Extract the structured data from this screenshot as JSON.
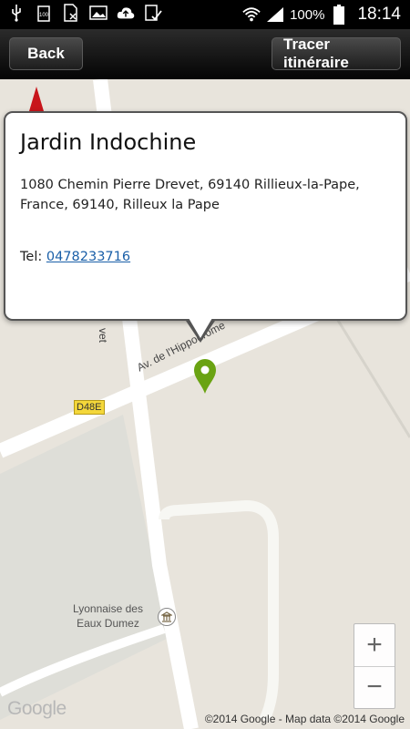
{
  "status_bar": {
    "battery_percent": "100%",
    "time": "18:14",
    "icons": [
      "usb-icon",
      "battery-100-icon",
      "sim-icon",
      "image-icon",
      "cloud-upload-icon",
      "check-clipboard-icon",
      "wifi-icon",
      "signal-icon",
      "battery-icon"
    ]
  },
  "action_bar": {
    "back_label": "Back",
    "route_label": "Tracer itinéraire"
  },
  "popup": {
    "title": "Jardin Indochine",
    "address": "1080 Chemin Pierre Drevet, 69140 Rillieux-la-Pape, France, 69140, Rilleux la Pape",
    "tel_prefix": "Tel: ",
    "tel_number": "0478233716"
  },
  "map": {
    "road_badge": "D48E",
    "street_main": "Av. de l'Hippodrome",
    "street_side": "vet",
    "poi_line1": "Lyonnaise des",
    "poi_line2": "Eaux Dumez",
    "google_logo": "Google",
    "credit": "©2014 Google - Map data ©2014 Google",
    "marker_color": "#6aa312",
    "zoom_in": "+",
    "zoom_out": "−"
  }
}
